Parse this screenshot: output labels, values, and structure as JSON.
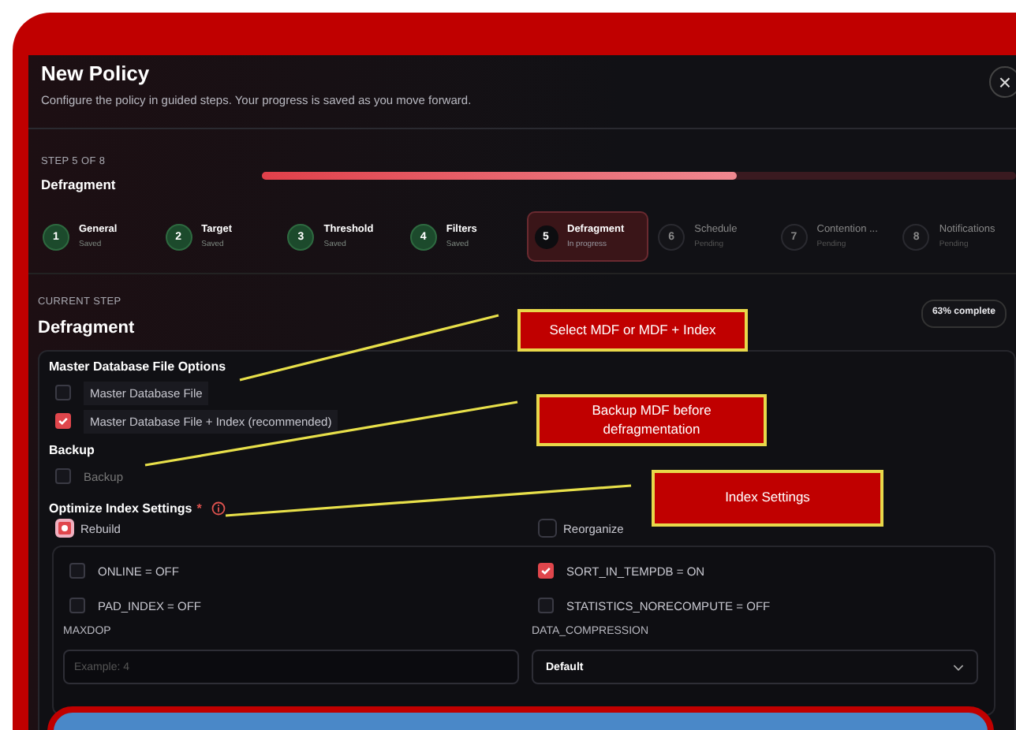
{
  "dialog": {
    "title": "New Policy",
    "subtitle": "Configure the policy in guided steps. Your progress is saved as you move forward.",
    "close_icon": "×"
  },
  "progress": {
    "step_label": "STEP 5 OF 8",
    "step_name": "Defragment",
    "level": 0.63
  },
  "steps": [
    {
      "number": "1",
      "name": "General",
      "status": "Saved",
      "completed": true,
      "selected": false
    },
    {
      "number": "2",
      "name": "Target",
      "status": "Saved",
      "completed": true,
      "selected": false
    },
    {
      "number": "3",
      "name": "Threshold",
      "status": "Saved",
      "completed": true,
      "selected": false
    },
    {
      "number": "4",
      "name": "Filters",
      "status": "Saved",
      "completed": true,
      "selected": false
    },
    {
      "number": "5",
      "name": "Defragment",
      "status": "In progress",
      "completed": false,
      "selected": true
    },
    {
      "number": "6",
      "name": "Schedule",
      "status": "Pending",
      "completed": false,
      "selected": false
    },
    {
      "number": "7",
      "name": "Contention ...",
      "status": "Pending",
      "completed": false,
      "selected": false
    },
    {
      "number": "8",
      "name": "Notifications",
      "status": "Pending",
      "completed": false,
      "selected": false
    }
  ],
  "current": {
    "label": "CURRENT STEP",
    "name": "Defragment",
    "badge": "63% complete"
  },
  "mdf": {
    "heading": "Master Database File Options",
    "options": [
      {
        "label": "Master Database File",
        "checked": false
      },
      {
        "label": "Master Database File + Index (recommended)",
        "checked": true
      }
    ]
  },
  "backup": {
    "heading": "Backup",
    "options": [
      {
        "label": "Backup",
        "checked": false
      }
    ]
  },
  "index": {
    "heading": "Optimize Index Settings",
    "required_mark": "*",
    "modes": [
      {
        "label": "Rebuild",
        "selected": true
      },
      {
        "label": "Reorganize",
        "selected": false
      }
    ],
    "flags": [
      {
        "label": "ONLINE = OFF",
        "checked": false
      },
      {
        "label": "SORT_IN_TEMPDB = ON",
        "checked": true
      },
      {
        "label": "PAD_INDEX = OFF",
        "checked": false
      },
      {
        "label": "STATISTICS_NORECOMPUTE = OFF",
        "checked": false
      }
    ],
    "maxdop": {
      "label": "MAXDOP",
      "placeholder": "Example: 4"
    },
    "compression": {
      "label": "DATA_COMPRESSION",
      "value": "Default"
    }
  },
  "callouts": [
    {
      "text": "Select MDF or MDF + Index"
    },
    {
      "text": "Backup MDF before defragmentation"
    },
    {
      "text": "Index Settings"
    }
  ]
}
